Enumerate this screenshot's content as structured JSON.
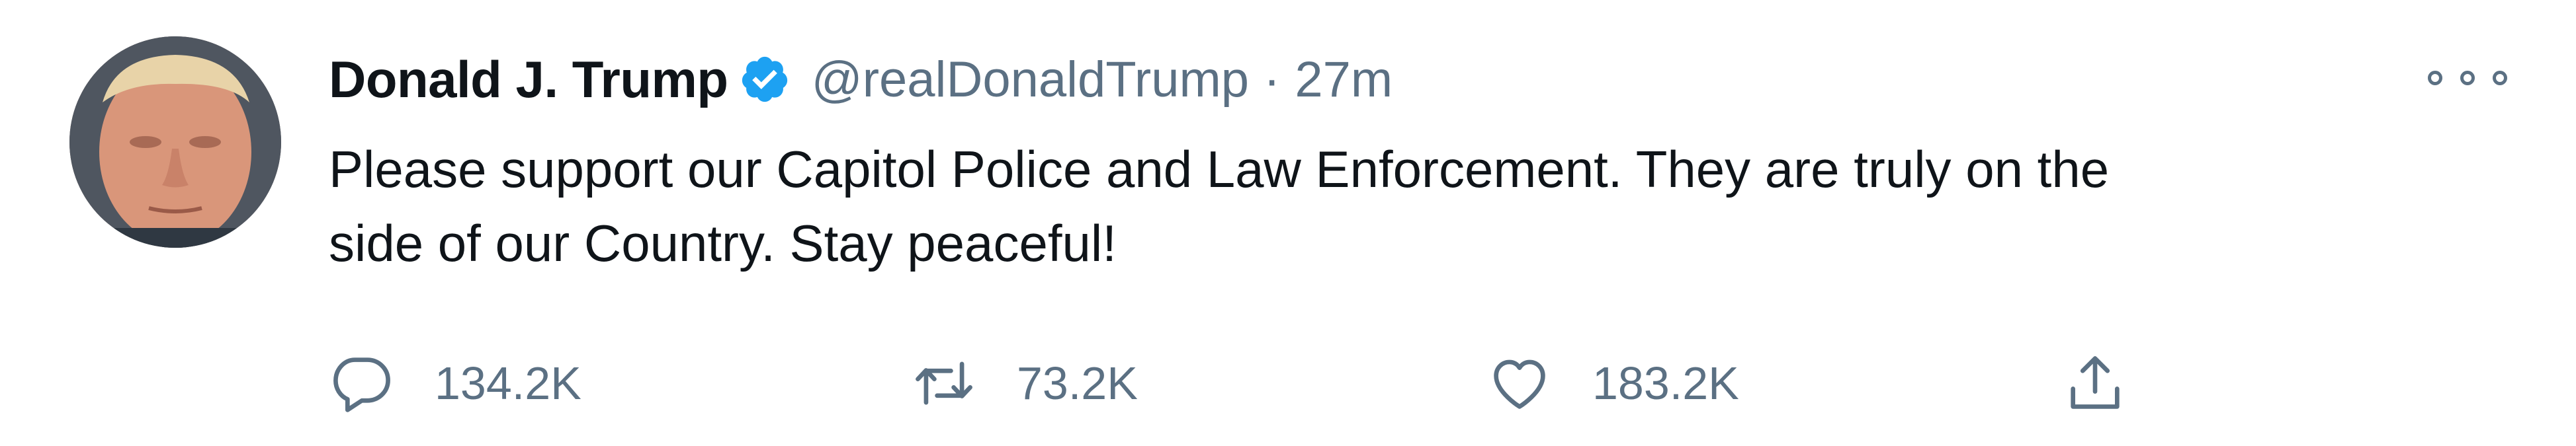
{
  "tweet": {
    "author_name": "Donald J. Trump",
    "handle": "@realDonaldTrump",
    "separator": "·",
    "time": "27m",
    "text": "Please support our Capitol Police and Law Enforcement. They are truly on the\nside of our Country. Stay peaceful!",
    "verified": true
  },
  "actions": {
    "replies": "134.2K",
    "retweets": "73.2K",
    "likes": "183.2K"
  },
  "icons": {
    "verified": "verified-badge-icon",
    "more": "more-icon",
    "reply": "reply-icon",
    "retweet": "retweet-icon",
    "like": "heart-icon",
    "share": "share-icon"
  },
  "colors": {
    "verified_blue": "#1da1f2",
    "secondary_text": "#5b7083",
    "primary_text": "#0f1419"
  }
}
